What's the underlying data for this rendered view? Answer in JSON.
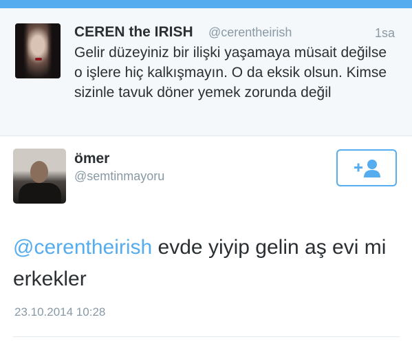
{
  "tweet": {
    "author_name": "CEREN the IRISH",
    "author_handle": "@cerentheirish",
    "time": "1sa",
    "text": "Gelir düzeyiniz bir ilişki yaşamaya müsait değilse o işlere hiç kalkışmayın. O da eksik olsun. Kimse sizinle tavuk döner yemek zorunda değil"
  },
  "reply": {
    "author_name": "ömer",
    "author_handle": "@semtinmayoru",
    "mention": "@cerentheirish",
    "text": " evde yiyip gelin aş evi mi erkekler",
    "date": "23.10.2014 10:28"
  },
  "icons": {
    "follow": "add-user-icon"
  },
  "colors": {
    "accent": "#55acee",
    "muted": "#8899a6",
    "text": "#292f33"
  }
}
